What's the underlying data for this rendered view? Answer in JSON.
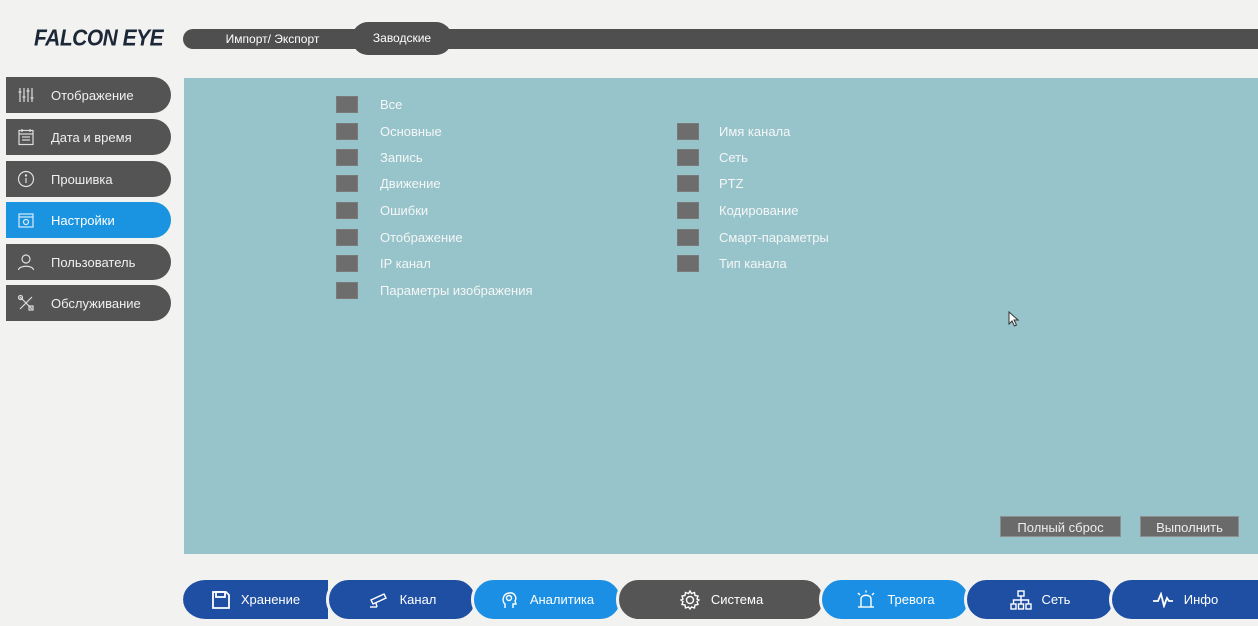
{
  "brand": {
    "logo": "FALCON EYE"
  },
  "top_tabs": [
    {
      "label": "Импорт/ Экспорт"
    },
    {
      "label": "Заводские",
      "active": true
    }
  ],
  "sidebar": {
    "items": [
      {
        "label": "Отображение",
        "icon": "sliders-icon"
      },
      {
        "label": "Дата и время",
        "icon": "calendar-icon"
      },
      {
        "label": "Прошивка",
        "icon": "info-icon"
      },
      {
        "label": "Настройки",
        "icon": "settings-folder-icon",
        "active": true
      },
      {
        "label": "Пользователь",
        "icon": "user-icon"
      },
      {
        "label": "Обслуживание",
        "icon": "tools-icon"
      }
    ]
  },
  "checkboxes": {
    "left": [
      {
        "label": "Все",
        "checked": false
      },
      {
        "label": "Основные",
        "checked": false
      },
      {
        "label": "Запись",
        "checked": false
      },
      {
        "label": "Движение",
        "checked": false
      },
      {
        "label": "Ошибки",
        "checked": false
      },
      {
        "label": "Отображение",
        "checked": false
      },
      {
        "label": "IP канал",
        "checked": false
      },
      {
        "label": "Параметры изображения",
        "checked": false
      }
    ],
    "right": [
      {
        "label": "Имя канала",
        "checked": false
      },
      {
        "label": "Сеть",
        "checked": false
      },
      {
        "label": "PTZ",
        "checked": false
      },
      {
        "label": "Кодирование",
        "checked": false
      },
      {
        "label": "Смарт-параметры",
        "checked": false
      },
      {
        "label": "Тип канала",
        "checked": false
      }
    ]
  },
  "actions": {
    "reset_label": "Полный сброс",
    "apply_label": "Выполнить"
  },
  "bottom_nav": [
    {
      "label": "Хранение",
      "icon": "floppy-icon"
    },
    {
      "label": "Канал",
      "icon": "camera-icon"
    },
    {
      "label": "Аналитика",
      "icon": "analytics-icon"
    },
    {
      "label": "Система",
      "icon": "gear-icon",
      "active": true
    },
    {
      "label": "Тревога",
      "icon": "alarm-icon"
    },
    {
      "label": "Сеть",
      "icon": "network-icon"
    },
    {
      "label": "Инфо",
      "icon": "pulse-icon"
    }
  ],
  "colors": {
    "panel": "#97c3ca",
    "active_blue": "#1a93e0",
    "dark_blue": "#1f4fa3",
    "sidebar_gray": "#545454"
  }
}
